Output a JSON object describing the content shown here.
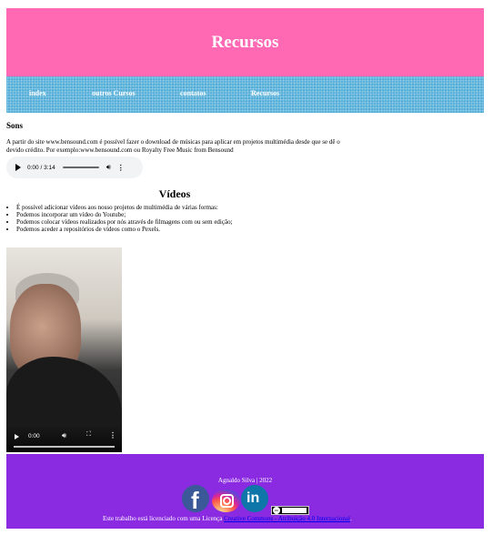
{
  "header": {
    "title": "Recursos"
  },
  "nav": {
    "items": [
      "index",
      "outros Cursos",
      "contatos",
      "Recursos"
    ]
  },
  "sons": {
    "title": "Sons",
    "text": "A partir do site www.bensound.com é possível fazer o download de músicas para aplicar em projetos multimédia desde que se dê o devido crédito. Por exemplo:www.bensound.com ou Royalty Free Music from Bensound",
    "audio": {
      "time": "0:00 / 3:14"
    }
  },
  "videos": {
    "title": "Vídeos",
    "items": [
      "É possível adicionar vídeos aos nosso projetos de multimédia de várias formas:",
      "Podemos incorporar um vídeo do Youtube;",
      "Podemos colocar vídeos realizados por nós através de filmagens com ou sem edição;",
      "Podemos aceder a repositórios de vídeos como o Pexels."
    ],
    "player": {
      "time": "0:00"
    }
  },
  "footer": {
    "credit": "Agnaldo Silva | 2022",
    "license_text": "Este trabalho está licenciado com uma Licença ",
    "license_link": "Creative Commons - Atribuição 4.0 Internacional",
    "license_end": "."
  },
  "colors": {
    "header": "#ff69b4",
    "nav": "#5bb3dc",
    "footer": "#8a2be2",
    "link": "#0000ee"
  },
  "icons": [
    "facebook-icon",
    "instagram-icon",
    "linkedin-icon",
    "creative-commons-badge"
  ]
}
